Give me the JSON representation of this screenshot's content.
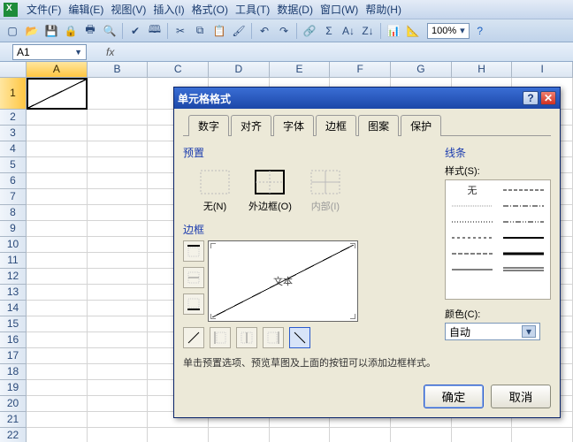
{
  "menu": {
    "items": [
      "文件(F)",
      "编辑(E)",
      "视图(V)",
      "插入(I)",
      "格式(O)",
      "工具(T)",
      "数据(D)",
      "窗口(W)",
      "帮助(H)"
    ]
  },
  "toolbar": {
    "zoom": "100%"
  },
  "namebox": {
    "value": "A1"
  },
  "fx_label": "fx",
  "columns": [
    "A",
    "B",
    "C",
    "D",
    "E",
    "F",
    "G",
    "H",
    "I"
  ],
  "rows": [
    "1",
    "2",
    "3",
    "4",
    "5",
    "6",
    "7",
    "8",
    "9",
    "10",
    "11",
    "12",
    "13",
    "14",
    "15",
    "16",
    "17",
    "18",
    "19",
    "20",
    "21",
    "22"
  ],
  "dialog": {
    "title": "单元格格式",
    "tabs": [
      "数字",
      "对齐",
      "字体",
      "边框",
      "图案",
      "保护"
    ],
    "active_tab": "边框",
    "preset_label": "预置",
    "presets": {
      "none": "无(N)",
      "outline": "外边框(O)",
      "inside": "内部(I)"
    },
    "border_label": "边框",
    "preview_text": "文本",
    "line_group": "线条",
    "style_label": "样式(S):",
    "style_none": "无",
    "color_label": "颜色(C):",
    "color_value": "自动",
    "hint": "单击预置选项、预览草图及上面的按钮可以添加边框样式。",
    "ok": "确定",
    "cancel": "取消"
  }
}
